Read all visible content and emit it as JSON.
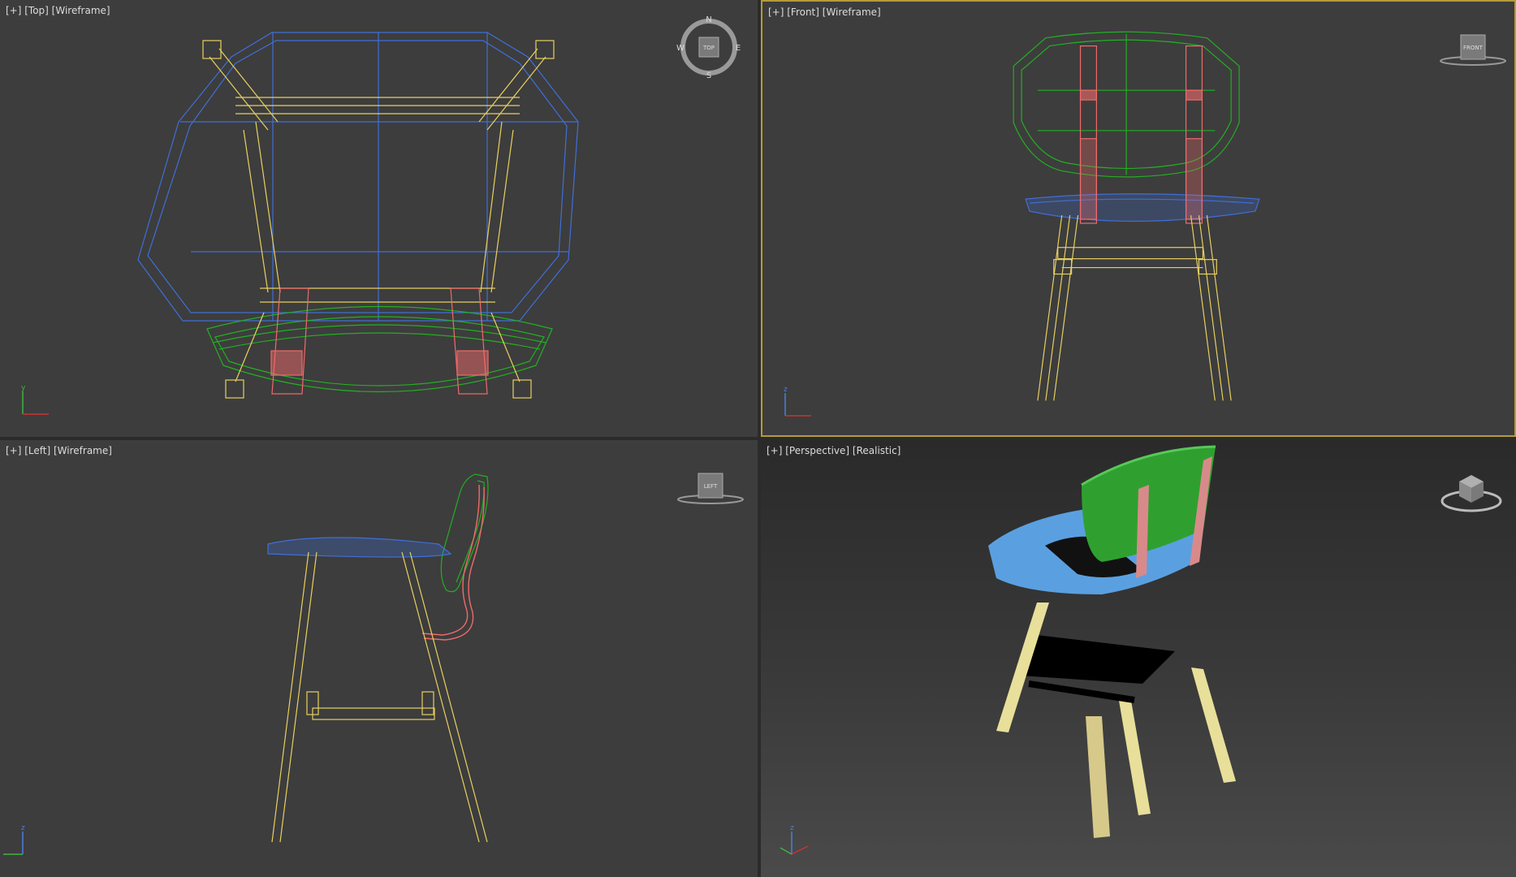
{
  "viewports": {
    "top": {
      "label": "[+] [Top] [Wireframe]"
    },
    "front": {
      "label": "[+] [Front] [Wireframe]"
    },
    "left": {
      "label": "[+] [Left] [Wireframe]"
    },
    "perspective": {
      "label": "[+] [Perspective] [Realistic]"
    }
  },
  "compass": {
    "n": "N",
    "s": "S",
    "e": "E",
    "w": "W",
    "cube": "TOP"
  },
  "viewcube": {
    "front": "FRONT",
    "left": "LEFT"
  },
  "axes": {
    "x": "x",
    "y": "y",
    "z": "z"
  },
  "colors": {
    "seat": "#3f6fd8",
    "back": "#22b022",
    "strap": "#f06a6a",
    "frame": "#e8d060",
    "active_border": "#b59a3a",
    "seat_solid": "#5aa0e0",
    "back_solid": "#2fa02f",
    "strap_solid": "#d88a8a",
    "frame_solid": "#e8df9a"
  }
}
